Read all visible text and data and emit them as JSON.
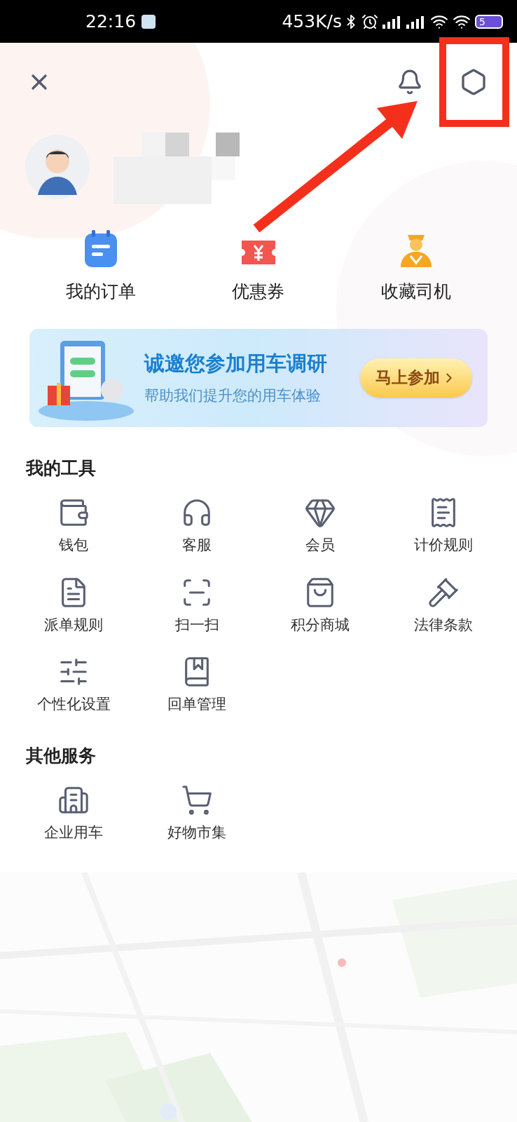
{
  "status_bar": {
    "time": "22:16",
    "speed": "453K/s",
    "battery": "5"
  },
  "shortcuts": [
    {
      "label": "我的订单"
    },
    {
      "label": "优惠券"
    },
    {
      "label": "收藏司机"
    }
  ],
  "banner": {
    "title": "诚邀您参加用车调研",
    "subtitle": "帮助我们提升您的用车体验",
    "button": "马上参加"
  },
  "tools": {
    "title": "我的工具",
    "items": [
      {
        "label": "钱包"
      },
      {
        "label": "客服"
      },
      {
        "label": "会员"
      },
      {
        "label": "计价规则"
      },
      {
        "label": "派单规则"
      },
      {
        "label": "扫一扫"
      },
      {
        "label": "积分商城"
      },
      {
        "label": "法律条款"
      },
      {
        "label": "个性化设置"
      },
      {
        "label": "回单管理"
      }
    ]
  },
  "other_services": {
    "title": "其他服务",
    "items": [
      {
        "label": "企业用车"
      },
      {
        "label": "好物市集"
      }
    ]
  }
}
